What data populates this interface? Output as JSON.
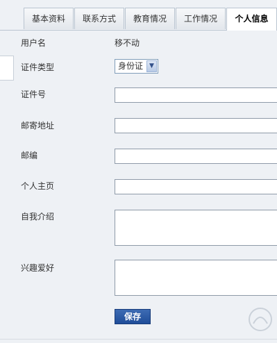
{
  "tabs": [
    {
      "label": "基本资料",
      "active": false
    },
    {
      "label": "联系方式",
      "active": false
    },
    {
      "label": "教育情况",
      "active": false
    },
    {
      "label": "工作情况",
      "active": false
    },
    {
      "label": "个人信息",
      "active": true
    }
  ],
  "form": {
    "username_label": "用户名",
    "username_value": "移不动",
    "id_type_label": "证件类型",
    "id_type_value": "身份证",
    "id_number_label": "证件号",
    "address_label": "邮寄地址",
    "zipcode_label": "邮编",
    "homepage_label": "个人主页",
    "intro_label": "自我介绍",
    "hobbies_label": "兴趣爱好",
    "save_label": "保存"
  },
  "icons": {
    "select_arrow": "chevron-down-icon"
  },
  "colors": {
    "background": "#eef1f5",
    "save_button": "#2a5aa8",
    "field_border": "#8e9aa8"
  }
}
